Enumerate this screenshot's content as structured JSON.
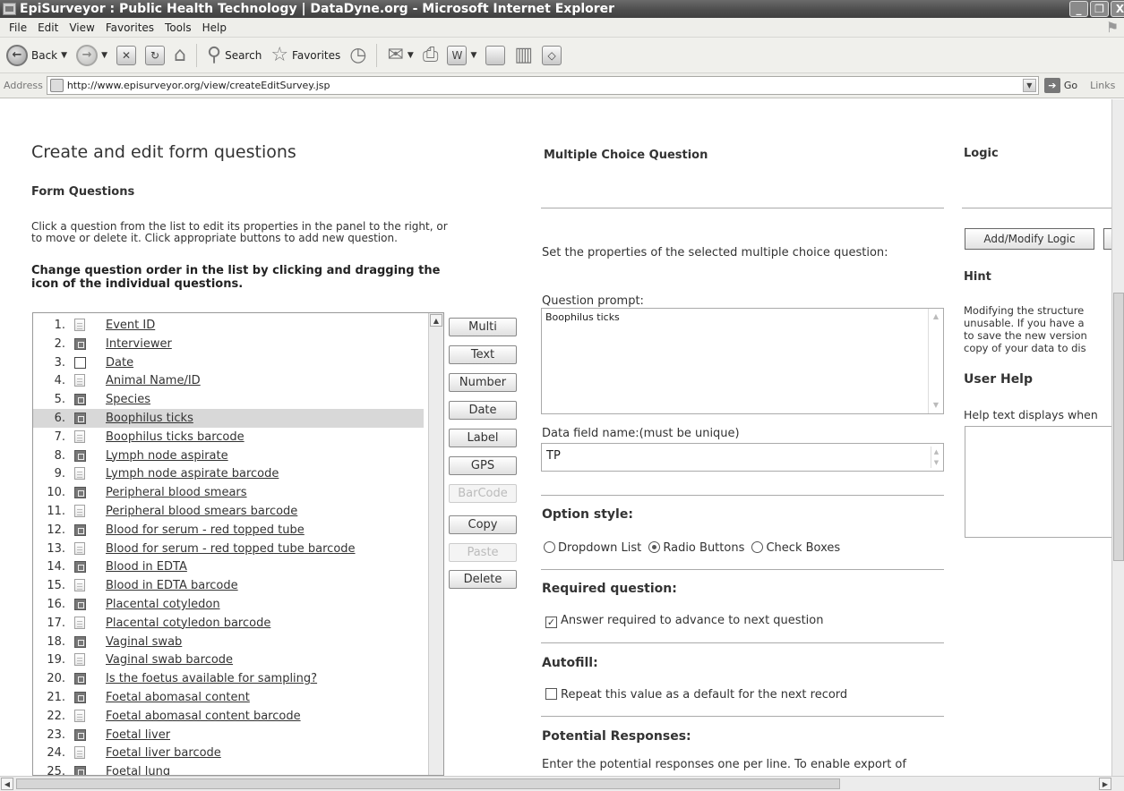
{
  "window": {
    "title": "EpiSurveyor : Public Health Technology | DataDyne.org - Microsoft Internet Explorer",
    "controls": [
      "_",
      "❐",
      "X"
    ]
  },
  "menu": [
    "File",
    "Edit",
    "View",
    "Favorites",
    "Tools",
    "Help"
  ],
  "toolbar": {
    "back": "Back",
    "search": "Search",
    "favorites": "Favorites"
  },
  "address": {
    "label": "Address",
    "url": "http://www.episurveyor.org/view/createEditSurvey.jsp",
    "go": "Go",
    "links": "Links"
  },
  "page": {
    "title": "Create and edit form questions",
    "section": "Form Questions",
    "description": "Click a question from the list to edit its properties in the panel to the right, or to move or delete it. Click appropriate buttons to add new question.",
    "instruction": "Change question order in the list by clicking and dragging the icon of the individual questions."
  },
  "questions": [
    {
      "num": "1.",
      "label": "Event ID",
      "icon": "doc"
    },
    {
      "num": "2.",
      "label": "Interviewer",
      "icon": "mc"
    },
    {
      "num": "3.",
      "label": "Date",
      "icon": "box"
    },
    {
      "num": "4.",
      "label": "Animal Name/ID",
      "icon": "doc"
    },
    {
      "num": "5.",
      "label": "Species",
      "icon": "mc"
    },
    {
      "num": "6.",
      "label": "Boophilus ticks",
      "icon": "mc"
    },
    {
      "num": "7.",
      "label": "Boophilus ticks barcode",
      "icon": "doc"
    },
    {
      "num": "8.",
      "label": "Lymph node aspirate",
      "icon": "mc"
    },
    {
      "num": "9.",
      "label": "Lymph node aspirate barcode",
      "icon": "doc"
    },
    {
      "num": "10.",
      "label": "Peripheral blood smears",
      "icon": "mc"
    },
    {
      "num": "11.",
      "label": "Peripheral blood smears barcode",
      "icon": "doc"
    },
    {
      "num": "12.",
      "label": "Blood for serum - red topped tube",
      "icon": "mc"
    },
    {
      "num": "13.",
      "label": "Blood for serum - red topped tube barcode",
      "icon": "doc"
    },
    {
      "num": "14.",
      "label": "Blood in EDTA",
      "icon": "mc"
    },
    {
      "num": "15.",
      "label": "Blood in EDTA barcode",
      "icon": "doc"
    },
    {
      "num": "16.",
      "label": "Placental cotyledon",
      "icon": "mc"
    },
    {
      "num": "17.",
      "label": "Placental cotyledon barcode",
      "icon": "doc"
    },
    {
      "num": "18.",
      "label": "Vaginal swab",
      "icon": "mc"
    },
    {
      "num": "19.",
      "label": "Vaginal swab barcode",
      "icon": "doc"
    },
    {
      "num": "20.",
      "label": "Is the foetus available for sampling?",
      "icon": "mc"
    },
    {
      "num": "21.",
      "label": "Foetal abomasal content",
      "icon": "mc"
    },
    {
      "num": "22.",
      "label": "Foetal abomasal content barcode",
      "icon": "doc"
    },
    {
      "num": "23.",
      "label": "Foetal liver",
      "icon": "mc"
    },
    {
      "num": "24.",
      "label": "Foetal liver barcode",
      "icon": "doc"
    },
    {
      "num": "25.",
      "label": "Foetal lung",
      "icon": "mc"
    }
  ],
  "selected_question": "6.",
  "add_buttons": [
    "Multi",
    "Text",
    "Number",
    "Date",
    "Label",
    "GPS",
    "BarCode"
  ],
  "disabled_buttons": [
    "BarCode",
    "Paste"
  ],
  "edit_buttons": [
    "Copy",
    "Paste",
    "Delete"
  ],
  "editor": {
    "title": "Multiple Choice Question",
    "intro": "Set the properties of the selected multiple choice question:",
    "prompt_label": "Question prompt:",
    "prompt_value": "Boophilus ticks",
    "field_label": "Data field name:(must be unique)",
    "field_value": "TP",
    "option_style_heading": "Option style:",
    "option_styles": [
      "Dropdown List",
      "Radio Buttons",
      "Check Boxes"
    ],
    "selected_option_style": "Radio Buttons",
    "required_heading": "Required question:",
    "required_label": "Answer required to advance to next question",
    "required_checked": true,
    "autofill_heading": "Autofill:",
    "autofill_label": "Repeat this value as a default for the next record",
    "autofill_checked": false,
    "responses_heading": "Potential Responses:",
    "responses_text": "Enter the potential responses one per line. To enable export of"
  },
  "logic": {
    "title": "Logic",
    "button": "Add/Modify Logic",
    "hint_heading": "Hint",
    "hint_lines": [
      "Modifying the structure",
      "unusable. If you have a",
      "to save the new version",
      "copy of your data to dis"
    ],
    "help_heading": "User Help",
    "help_text": "Help text displays when"
  }
}
